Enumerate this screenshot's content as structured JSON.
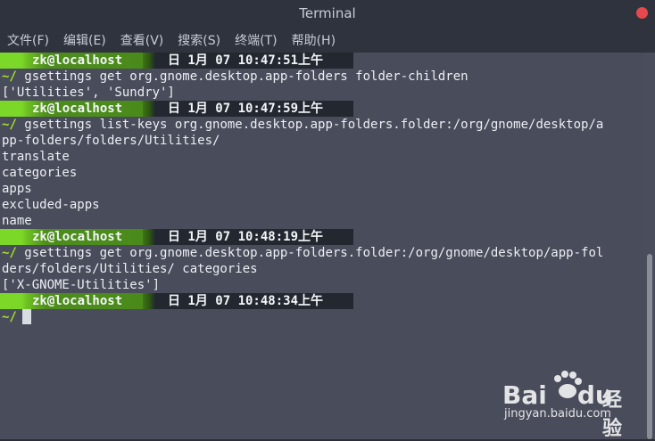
{
  "window": {
    "title": "Terminal"
  },
  "menu": [
    "文件(F)",
    "编辑(E)",
    "查看(V)",
    "搜索(S)",
    "终端(T)",
    "帮助(H)"
  ],
  "terminal": {
    "tilde": "~/",
    "blocks": [
      {
        "user": "zk@localhost",
        "date": "日 1月  07 10:47:51上午",
        "command": "gsettings get org.gnome.desktop.app-folders folder-children",
        "output": [
          "['Utilities', 'Sundry']"
        ]
      },
      {
        "user": "zk@localhost",
        "date": "日 1月  07 10:47:59上午",
        "command": "gsettings list-keys org.gnome.desktop.app-folders.folder:/org/gnome/desktop/a",
        "command_wrap": "pp-folders/folders/Utilities/",
        "output": [
          "translate",
          "categories",
          "apps",
          "excluded-apps",
          "name"
        ]
      },
      {
        "user": "zk@localhost",
        "date": "日 1月  07 10:48:19上午",
        "command": "gsettings get org.gnome.desktop.app-folders.folder:/org/gnome/desktop/app-fol",
        "command_wrap": "ders/folders/Utilities/ categories",
        "output": [
          "['X-GNOME-Utilities']"
        ]
      },
      {
        "user": "zk@localhost",
        "date": "日 1月  07 10:48:34上午",
        "command": "",
        "output": []
      }
    ]
  },
  "watermark": {
    "brand": "Bai",
    "brand2": "du",
    "cn": "经验",
    "url": "jingyan.baidu.com"
  },
  "colors": {
    "accent_green": "#7bd828",
    "prompt_bg": "#232730",
    "terminal_bg": "#494c5a"
  }
}
